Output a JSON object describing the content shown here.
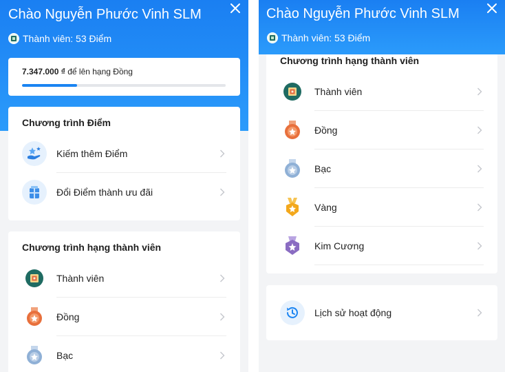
{
  "left": {
    "greeting": "Chào Nguyễn Phước Vinh SLM",
    "member_text": "Thành viên: 53 Điểm",
    "progress": {
      "amount": "7.347.000 ₫",
      "suffix": " để lên hạng Đồng",
      "fraction": 0.27
    },
    "points_section": {
      "title": "Chương trình Điểm",
      "items": [
        {
          "label": "Kiếm thêm Điểm",
          "icon": "earn-points-icon"
        },
        {
          "label": "Đổi Điểm thành ưu đãi",
          "icon": "redeem-points-icon"
        }
      ]
    },
    "tier_section": {
      "title": "Chương trình hạng thành viên",
      "items": [
        {
          "label": "Thành viên",
          "icon": "member-tier-icon"
        },
        {
          "label": "Đồng",
          "icon": "bronze-medal-icon"
        },
        {
          "label": "Bạc",
          "icon": "silver-medal-icon"
        }
      ]
    }
  },
  "right": {
    "greeting": "Chào Nguyễn Phước Vinh SLM",
    "member_text": "Thành viên: 53 Điểm",
    "tier_section": {
      "title": "Chương trình hạng thành viên",
      "items": [
        {
          "label": "Thành viên",
          "icon": "member-tier-icon"
        },
        {
          "label": "Đồng",
          "icon": "bronze-medal-icon"
        },
        {
          "label": "Bạc",
          "icon": "silver-medal-icon"
        },
        {
          "label": "Vàng",
          "icon": "gold-medal-icon"
        },
        {
          "label": "Kim Cương",
          "icon": "diamond-medal-icon"
        }
      ]
    },
    "history": {
      "label": "Lịch sử hoạt động",
      "icon": "history-icon"
    }
  },
  "colors": {
    "header": "#1e8df5",
    "progress": "#1a84f2",
    "bronze": "#e8703c",
    "silver": "#8fb0d6",
    "gold": "#f3a81c",
    "diamond": "#8a6cc2",
    "member": "#1f6b62"
  }
}
